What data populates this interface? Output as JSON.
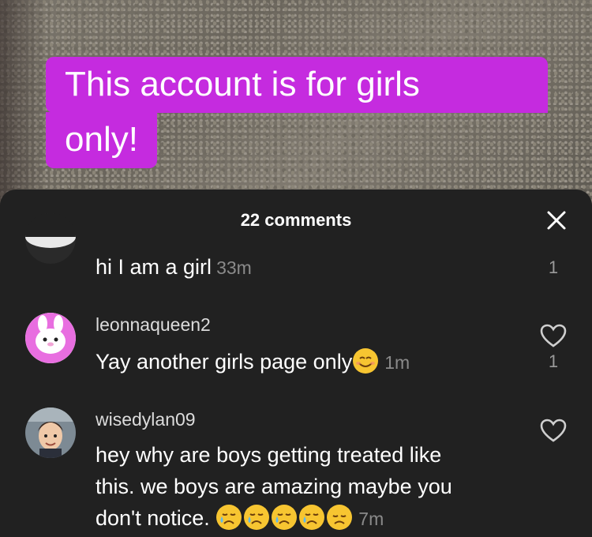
{
  "video": {
    "caption_line1": "This account is for girls",
    "caption_line2": "only!",
    "caption_bg": "#c52bdf"
  },
  "sheet": {
    "comment_count": "22 comments",
    "close_icon": "close-icon"
  },
  "comments": [
    {
      "username": "",
      "text": "hi I am a girl",
      "time": "33m",
      "likes": "1"
    },
    {
      "username": "leonnaqueen2",
      "text": "Yay another girls page only",
      "emoji": [
        "smiling-face"
      ],
      "time": "1m",
      "likes": "1"
    },
    {
      "username": "wisedylan09",
      "text_line1": "hey why are boys getting treated like",
      "text_line2": "this. we boys are amazing maybe you",
      "text_line3": "don't notice.",
      "emoji": [
        "crying-face",
        "crying-face",
        "crying-face",
        "crying-face",
        "disappointed-face"
      ],
      "time": "7m",
      "likes": ""
    }
  ]
}
